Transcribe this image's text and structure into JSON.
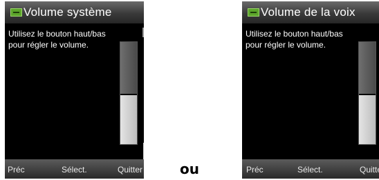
{
  "screens": [
    {
      "title": "Volume système",
      "instructions": "Utilisez le bouton haut/bas pour régler le volume.",
      "volume_level_fraction": 0.48,
      "softkeys": {
        "left": "Préc",
        "center": "Sélect.",
        "right": "Quitter"
      }
    },
    {
      "title": "Volume de la voix",
      "instructions": "Utilisez le bouton haut/bas pour régler le volume.",
      "volume_level_fraction": 0.48,
      "softkeys": {
        "left": "Préc",
        "center": "Sélect.",
        "right": "Quitter"
      }
    }
  ],
  "separator": "ou",
  "colors": {
    "title_icon": "#5ca52b",
    "volume_fill": "#d6d6d6",
    "volume_empty": "#5e5e5e",
    "screen_background": "#000000"
  },
  "icons": [
    "volume-app-icon"
  ]
}
